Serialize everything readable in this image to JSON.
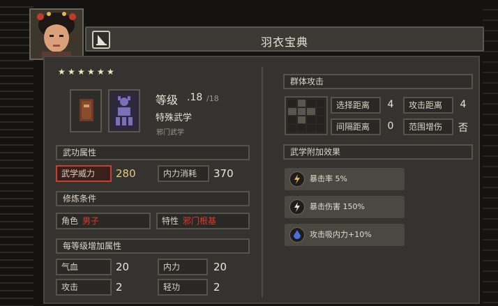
{
  "window": {
    "title": "羽衣宝典"
  },
  "skill": {
    "stars": 6,
    "level_label": "等级",
    "level_value": ".18",
    "level_max": "/18",
    "type": "特殊武学",
    "school": "邪门武学"
  },
  "attributes": {
    "header": "武功属性",
    "power_label": "武学威力",
    "power_value": "280",
    "inner_cost_label": "内力消耗",
    "inner_cost_value": "370"
  },
  "requirements": {
    "header": "修炼条件",
    "role_label": "角色",
    "role_value": "男子",
    "trait_label": "特性",
    "trait_value": "邪门根基"
  },
  "per_level": {
    "header": "每等级增加属性",
    "items": [
      {
        "label": "气血",
        "value": "20"
      },
      {
        "label": "内力",
        "value": "20"
      },
      {
        "label": "攻击",
        "value": "2"
      },
      {
        "label": "轻功",
        "value": "2"
      }
    ]
  },
  "aoe": {
    "header": "群体攻击",
    "select_range_label": "选择距离",
    "select_range_value": "4",
    "attack_range_label": "攻击距离",
    "attack_range_value": "4",
    "gap_range_label": "间隔距离",
    "gap_range_value": "0",
    "area_boost_label": "范围增伤",
    "area_boost_value": "否"
  },
  "effects": {
    "header": "武学附加效果",
    "items": [
      {
        "text": "暴击率 5%",
        "icon": "lightning-icon",
        "color": "#e0b84a"
      },
      {
        "text": "暴击伤害 150%",
        "icon": "lightning-icon",
        "color": "#e8e4da"
      },
      {
        "text": "攻击吸内力+10%",
        "icon": "drop-icon",
        "color": "#4a6ee0"
      }
    ]
  },
  "colors": {
    "accent_red": "#c4402f",
    "gold": "#e4c880"
  }
}
